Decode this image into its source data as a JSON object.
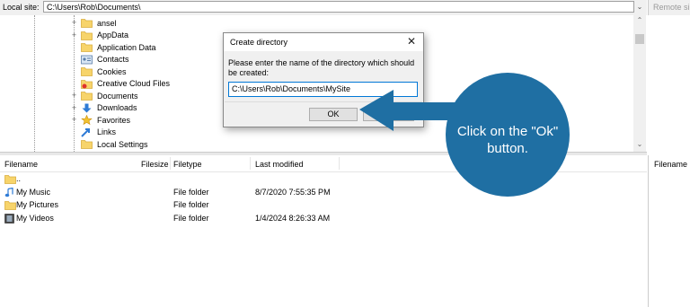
{
  "toolbar": {
    "local_site_label": "Local site:",
    "local_site_path": "C:\\Users\\Rob\\Documents\\",
    "remote_site_label": "Remote si"
  },
  "tree": {
    "items": [
      {
        "label": "ansel",
        "icon": "folder-icon",
        "expandable": true
      },
      {
        "label": "AppData",
        "icon": "folder-icon",
        "expandable": true
      },
      {
        "label": "Application Data",
        "icon": "folder-icon",
        "expandable": false
      },
      {
        "label": "Contacts",
        "icon": "contacts-icon",
        "expandable": false
      },
      {
        "label": "Cookies",
        "icon": "folder-icon",
        "expandable": false
      },
      {
        "label": "Creative Cloud Files",
        "icon": "creative-cloud-icon",
        "expandable": false
      },
      {
        "label": "Documents",
        "icon": "folder-icon",
        "expandable": true
      },
      {
        "label": "Downloads",
        "icon": "download-icon",
        "expandable": true
      },
      {
        "label": "Favorites",
        "icon": "star-icon",
        "expandable": true
      },
      {
        "label": "Links",
        "icon": "link-icon",
        "expandable": false
      },
      {
        "label": "Local Settings",
        "icon": "folder-icon",
        "expandable": false
      }
    ]
  },
  "file_list": {
    "columns": [
      "Filename",
      "Filesize",
      "Filetype",
      "Last modified"
    ],
    "rows": [
      {
        "name": "..",
        "size": "",
        "type": "",
        "modified": "",
        "icon": "folder-icon"
      },
      {
        "name": "My Music",
        "size": "",
        "type": "File folder",
        "modified": "8/7/2020 7:55:35 PM",
        "icon": "music-icon"
      },
      {
        "name": "My Pictures",
        "size": "",
        "type": "File folder",
        "modified": "",
        "icon": "folder-icon"
      },
      {
        "name": "My Videos",
        "size": "",
        "type": "File folder",
        "modified": "1/4/2024 8:26:33 AM",
        "icon": "video-icon"
      }
    ]
  },
  "remote_list": {
    "column": "Filename"
  },
  "dialog": {
    "title": "Create directory",
    "prompt": "Please enter the name of the directory which should be created:",
    "input_value": "C:\\Users\\Rob\\Documents\\MySite",
    "ok_label": "OK",
    "cancel_label": ""
  },
  "callout": {
    "text": "Click on the \"Ok\" button.",
    "color": "#1f6fa3"
  }
}
